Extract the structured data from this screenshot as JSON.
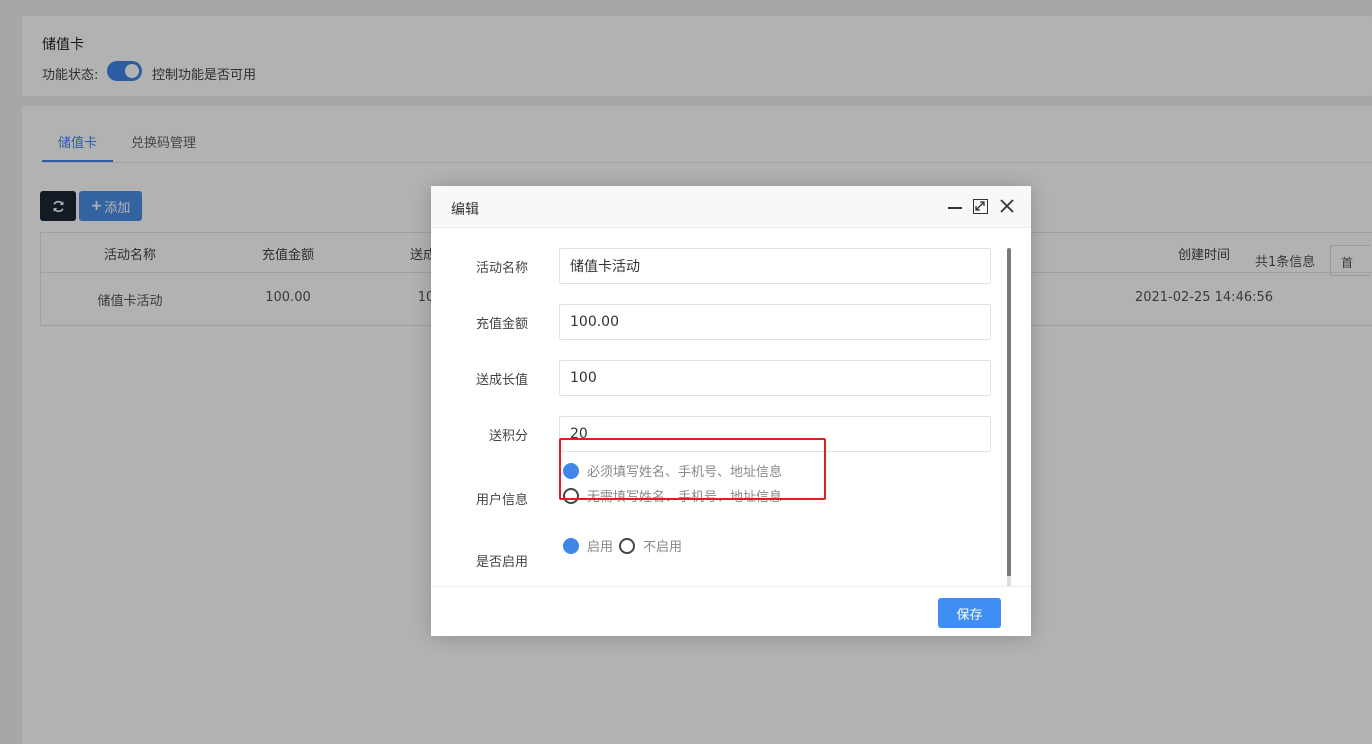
{
  "header": {
    "title": "储值卡",
    "status_label": "功能状态:",
    "status_enabled": true,
    "status_desc": "控制功能是否可用"
  },
  "tabs": [
    {
      "label": "储值卡",
      "active": true
    },
    {
      "label": "兑换码管理",
      "active": false
    }
  ],
  "toolbar": {
    "refresh_icon": "refresh-icon",
    "add_label": "添加",
    "add_icon": "plus-icon"
  },
  "table": {
    "columns": [
      "活动名称",
      "充值金额",
      "送成长值",
      "创建时间"
    ],
    "visible_headers": [
      "活动名称",
      "充值金额",
      "送成",
      "创建时间"
    ],
    "rows": [
      {
        "name": "储值卡活动",
        "amount": "100.00",
        "growth": "100",
        "created": "2021-02-25 14:46:56"
      }
    ],
    "row_visible": {
      "growth": "10"
    }
  },
  "pager": {
    "total": "共1条信息",
    "first": "首"
  },
  "dialog": {
    "title": "编辑",
    "fields": {
      "name": {
        "label": "活动名称",
        "value": "储值卡活动"
      },
      "amount": {
        "label": "充值金额",
        "value": "100.00"
      },
      "growth": {
        "label": "送成长值",
        "value": "100"
      },
      "points": {
        "label": "送积分",
        "value": "20"
      }
    },
    "user_info": {
      "label": "用户信息",
      "options": [
        "必须填写姓名、手机号、地址信息",
        "无需填写姓名、手机号、地址信息"
      ],
      "selected": 0
    },
    "enabled": {
      "label": "是否启用",
      "options": [
        "启用",
        "不启用"
      ],
      "selected": 0
    },
    "save_label": "保存"
  },
  "colors": {
    "accent": "#3f86e8",
    "highlight": "#e02020",
    "dark_button": "#1b2833"
  }
}
